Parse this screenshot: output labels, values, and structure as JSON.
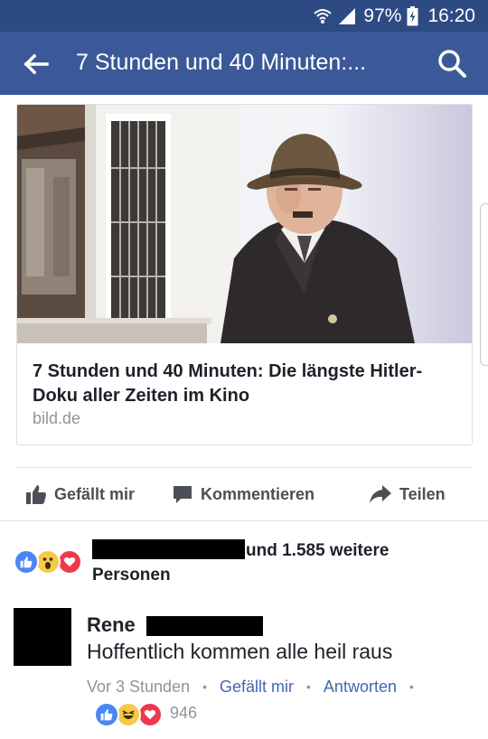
{
  "status_bar": {
    "battery_percent": "97%",
    "time": "16:20",
    "icons": [
      "wifi-calling-icon",
      "signal-icon",
      "battery-charging-icon"
    ]
  },
  "app_bar": {
    "title": "7 Stunden und 40 Minuten:...",
    "back_icon": "back-arrow-icon",
    "search_icon": "search-icon",
    "background": "#3b5998"
  },
  "link_preview": {
    "image": "photo-man-in-fedora-suit-beside-house",
    "title": "7 Stunden und 40 Minuten: Die längste Hitler-Doku aller Zeiten im Kino",
    "domain": "bild.de"
  },
  "actions": {
    "like": "Gefällt mir",
    "comment": "Kommentieren",
    "share": "Teilen"
  },
  "reactions_summary": {
    "icons": [
      "like-reaction-icon",
      "wow-reaction-icon",
      "love-reaction-icon"
    ],
    "text_line1": "und 1.585 weitere",
    "text_line2": "Personen"
  },
  "comment": {
    "author": "Rene",
    "text": "Hoffentlich kommen alle heil raus",
    "timestamp": "Vor 3 Stunden",
    "like_label": "Gefällt mir",
    "reply_label": "Antworten",
    "separator": "•",
    "reaction_icons": [
      "like-reaction-icon",
      "haha-reaction-icon",
      "love-reaction-icon"
    ],
    "reaction_count": "946"
  },
  "colors": {
    "brand": "#3b5998",
    "status_bar": "#2e4a83",
    "link_blue": "#4267b2",
    "like_blue": "#4a86f4",
    "love_red": "#f0394e",
    "wow_yellow": "#f7c948",
    "muted_text": "#90949c"
  }
}
